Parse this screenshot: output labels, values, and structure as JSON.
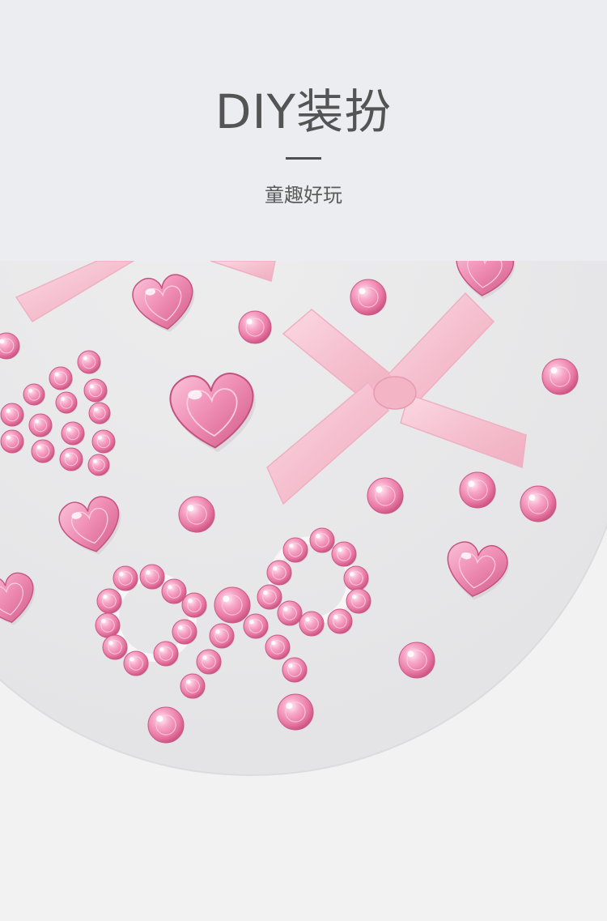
{
  "header": {
    "title": "DIY装扮",
    "subtitle": "童趣好玩"
  },
  "photo": {
    "subject": "pink-rhinestone-sticker-sheet"
  },
  "colors": {
    "header_bg": "#ecedf1",
    "title_text": "#545454",
    "photo_bg": "#f2f2f3",
    "sheet": "#e8e8ea",
    "gem_pink": "#f08fb4",
    "ribbon_pink": "#f6c6d3"
  }
}
